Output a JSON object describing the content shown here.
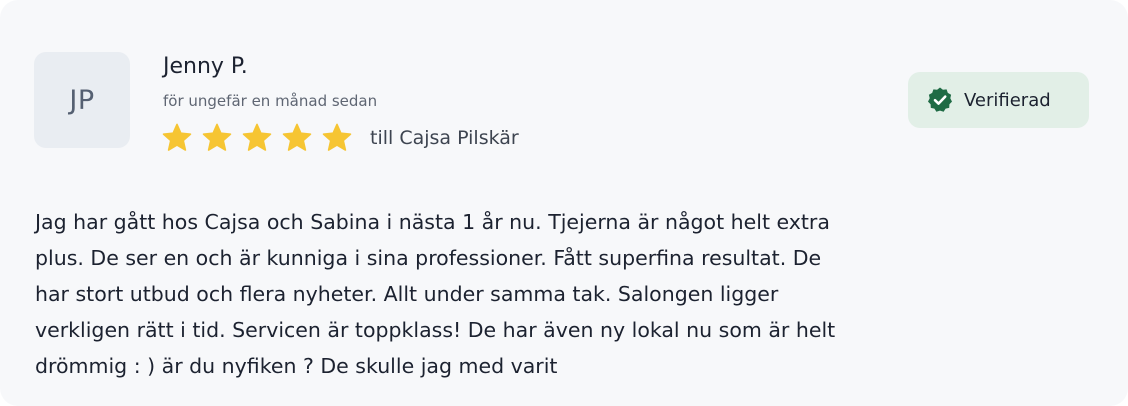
{
  "review": {
    "avatar_initials": "JP",
    "reviewer_name": "Jenny P.",
    "time_ago": "för ungefär en månad sedan",
    "rating": 5,
    "rating_max": 5,
    "staff_text": "till Cajsa Pilskär",
    "verified_label": "Verifierad",
    "body": "Jag har gått hos Cajsa och Sabina i nästa 1 år nu. Tjejerna är något helt extra\nplus. De ser en och är kunniga i sina professioner.  Fått superfina resultat. De\nhar stort utbud och flera nyheter. Allt under samma tak. Salongen ligger\nverkligen rätt i tid. Servicen är toppklass! De har även ny lokal nu som är helt\ndrömmig : ) är du nyfiken ? De skulle jag med varit"
  },
  "icons": {
    "star": "star-icon",
    "verified": "verified-check-icon"
  },
  "colors": {
    "card_background": "#f7f8fa",
    "star": "#f6c533",
    "verified_background": "#e2efe7",
    "verified_icon": "#1f6b45",
    "text_primary": "#1c2230",
    "text_secondary": "#5f6673"
  }
}
